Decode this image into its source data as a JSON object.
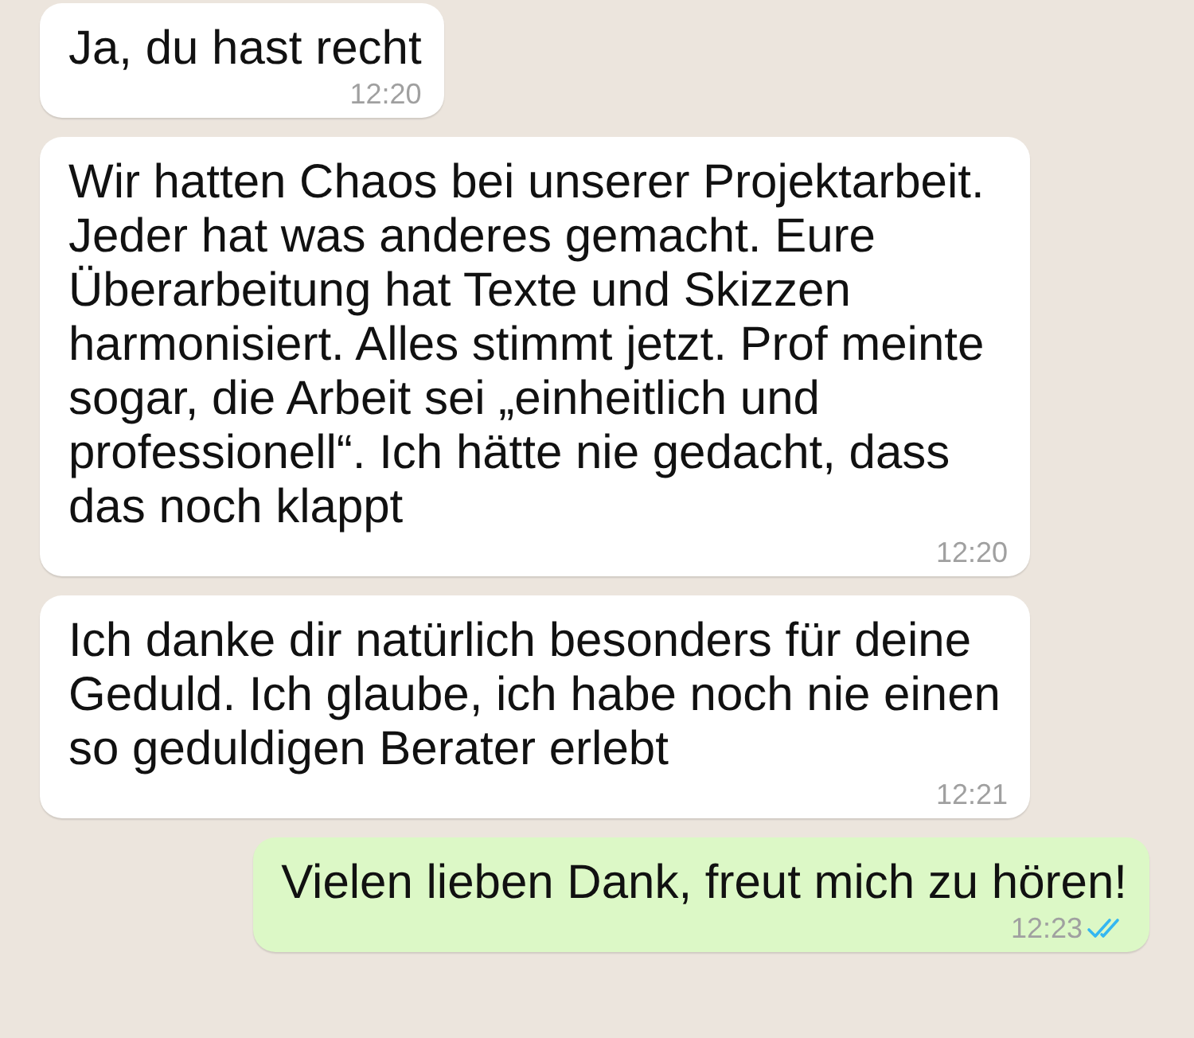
{
  "messages": [
    {
      "text": "Ja, du hast recht",
      "time": "12:20",
      "outgoing": false
    },
    {
      "text": "Wir hatten Chaos bei unserer Projektarbeit. Jeder hat was anderes gemacht. Eure Überarbeitung hat Texte und Skizzen harmonisiert. Alles stimmt jetzt. Prof meinte sogar, die Arbeit sei „einheitlich und professionell“. Ich hätte nie gedacht, dass das noch klappt",
      "time": "12:20",
      "outgoing": false
    },
    {
      "text": "Ich danke dir natürlich besonders für deine Geduld. Ich glaube, ich habe noch nie einen so geduldigen Berater erlebt",
      "time": "12:21",
      "outgoing": false
    },
    {
      "text": "Vielen lieben Dank, freut mich zu hören!",
      "time": "12:23",
      "outgoing": true,
      "read": true
    }
  ]
}
